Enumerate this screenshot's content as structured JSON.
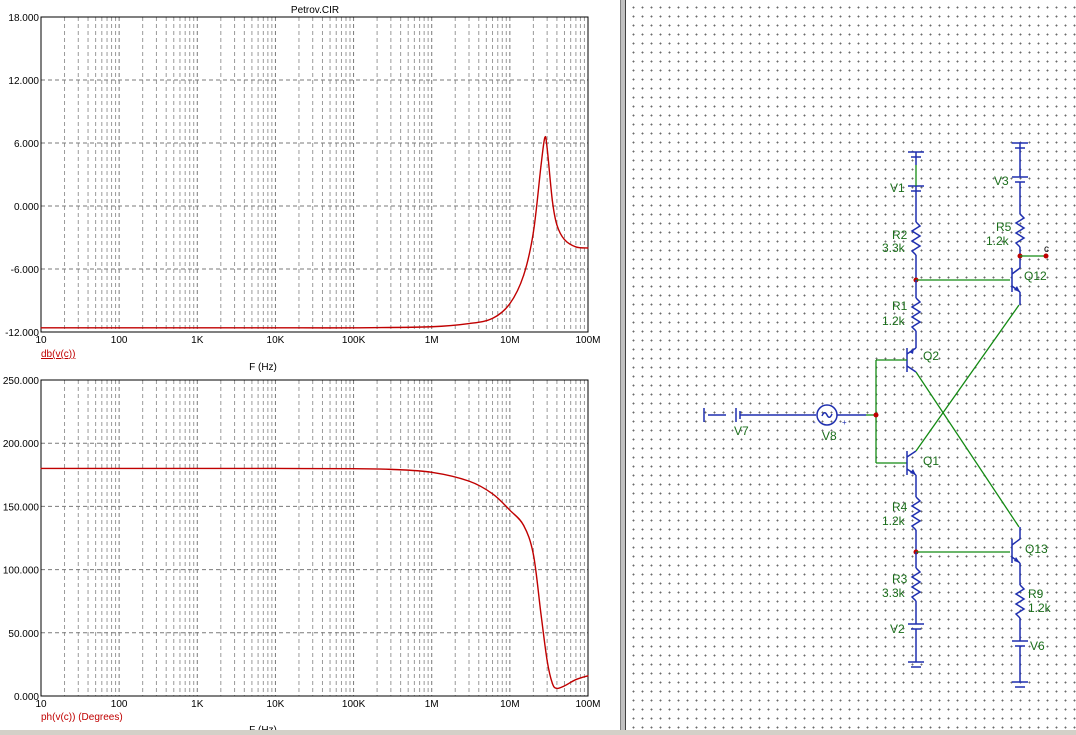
{
  "plot": {
    "title": "Petrov.CIR",
    "x_axis_label": "F (Hz)",
    "x_ticks": [
      "10",
      "100",
      "1K",
      "10K",
      "100K",
      "1M",
      "10M",
      "100M"
    ],
    "colors": {
      "trace": "#c00000",
      "grid": "#808080",
      "background": "#ffffff"
    }
  },
  "chart_data": [
    {
      "type": "line",
      "series": [
        {
          "name": "db(v(c))",
          "x": [
            10,
            100,
            1000,
            10000,
            100000,
            1000000,
            3000000,
            6000000,
            10000000,
            15000000,
            20000000,
            25000000,
            28000000,
            30000000,
            35000000,
            40000000,
            50000000,
            70000000,
            100000000
          ],
          "values": [
            -11.6,
            -11.6,
            -11.6,
            -11.6,
            -11.6,
            -11.5,
            -11.2,
            -10.7,
            -9.3,
            -6.6,
            -2.5,
            3.8,
            6.5,
            5.5,
            0.5,
            -1.8,
            -3.2,
            -3.9,
            -4.0
          ]
        }
      ],
      "x_scale": "log",
      "ylim": [
        -12,
        18
      ],
      "y_ticks": [
        "18.000",
        "12.000",
        "6.000",
        "0.000",
        "-6.000",
        "-12.000"
      ],
      "grid": true
    },
    {
      "type": "line",
      "series": [
        {
          "name": "ph(v(c)) (Degrees)",
          "x": [
            10,
            100,
            1000,
            10000,
            100000,
            300000,
            1000000,
            3000000,
            6000000,
            10000000,
            15000000,
            20000000,
            25000000,
            30000000,
            35000000,
            40000000,
            50000000,
            70000000,
            100000000
          ],
          "values": [
            180,
            180,
            180,
            180,
            179.8,
            179.3,
            177,
            170,
            160,
            147,
            135,
            112,
            65,
            28,
            10,
            6,
            8,
            13,
            16
          ]
        }
      ],
      "x_scale": "log",
      "ylim": [
        0,
        250
      ],
      "y_ticks": [
        "250.000",
        "200.000",
        "150.000",
        "100.000",
        "50.000",
        "0.000"
      ],
      "grid": true
    }
  ],
  "schematic": {
    "labels": {
      "V1": "V1",
      "V2": "V2",
      "V3": "V3",
      "V6": "V6",
      "V7": "V7",
      "V8": "V8",
      "R1": "R1",
      "R1v": "1.2k",
      "R2": "R2",
      "R2v": "3.3k",
      "R3": "R3",
      "R3v": "3.3k",
      "R4": "R4",
      "R4v": "1.2k",
      "R5": "R5",
      "R5v": "1.2k",
      "R9": "R9",
      "R9v": "1.2k",
      "Q1": "Q1",
      "Q2": "Q2",
      "Q12": "Q12",
      "Q13": "Q13",
      "node_c": "c"
    },
    "colors": {
      "wire": "#138a13",
      "component": "#1f2faf",
      "label": "#1a6e1a",
      "node": "#c00000"
    }
  }
}
